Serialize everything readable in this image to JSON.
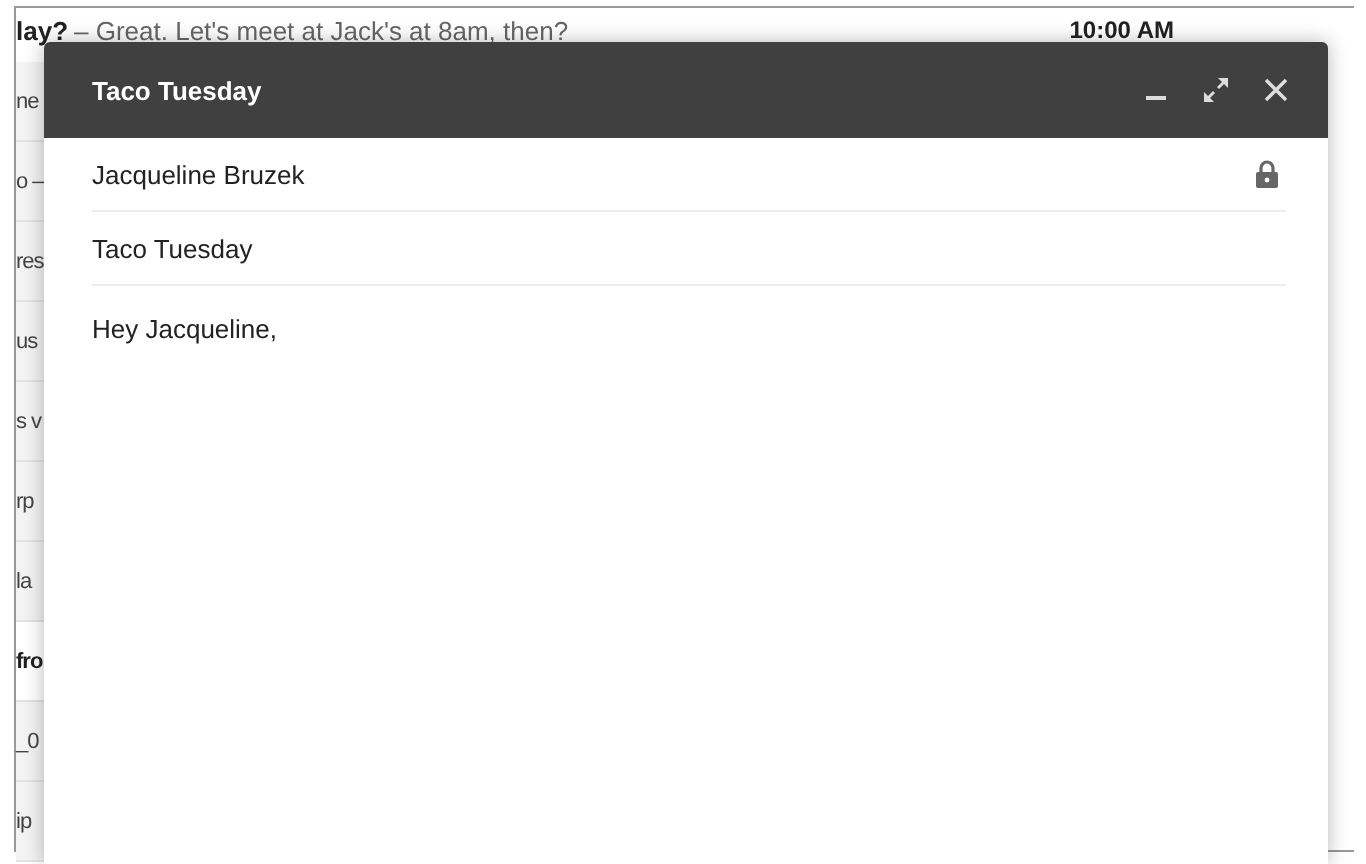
{
  "message_list": {
    "top_message": {
      "sender": "lay?",
      "snippet": "– Great. Let's meet at Jack's at 8am, then?",
      "time": "10:00 AM"
    },
    "rows": [
      {
        "text": "ne",
        "unread": false
      },
      {
        "text": "o –",
        "unread": false
      },
      {
        "text": "res",
        "unread": false
      },
      {
        "text": "us",
        "unread": false
      },
      {
        "text": "s v",
        "unread": false
      },
      {
        "text": "rp",
        "unread": false
      },
      {
        "text": "la",
        "unread": false
      },
      {
        "text": "fro",
        "unread": true
      },
      {
        "text": "_0",
        "unread": false
      },
      {
        "text": "ip",
        "unread": false
      }
    ]
  },
  "compose": {
    "title": "Taco Tuesday",
    "recipient": "Jacqueline Bruzek",
    "subject": "Taco Tuesday",
    "body": "Hey Jacqueline,"
  }
}
